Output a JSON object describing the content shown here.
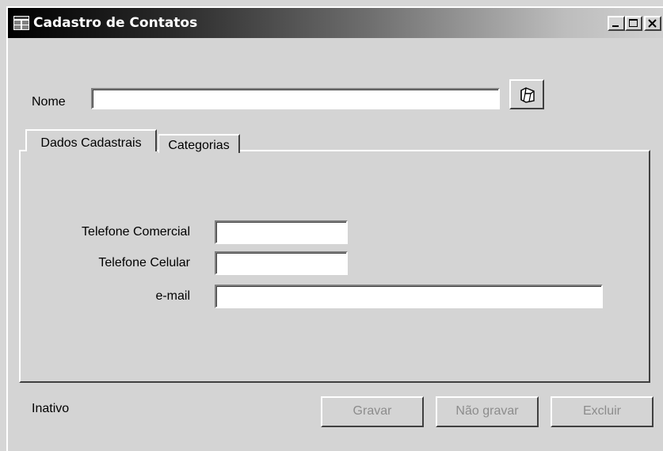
{
  "window": {
    "title": "Cadastro de Contatos",
    "controls": {
      "minimize": "minimize-icon",
      "maximize": "maximize-icon",
      "close": "close-icon"
    }
  },
  "form": {
    "nome_label": "Nome",
    "nome_value": "",
    "browse_icon": "folder-open-icon"
  },
  "tabs": [
    {
      "label": "Dados Cadastrais",
      "active": true
    },
    {
      "label": "Categorias",
      "active": false
    }
  ],
  "fields": {
    "telefone_comercial": {
      "label": "Telefone Comercial",
      "value": ""
    },
    "telefone_celular": {
      "label": "Telefone Celular",
      "value": ""
    },
    "email": {
      "label": "e-mail",
      "value": ""
    }
  },
  "status": "Inativo",
  "buttons": {
    "gravar": "Gravar",
    "nao_gravar": "Não gravar",
    "excluir": "Excluir"
  },
  "colors": {
    "title_gradient_start": "#000000",
    "face": "#d4d4d4",
    "disabled_text": "#8c8c8c"
  }
}
